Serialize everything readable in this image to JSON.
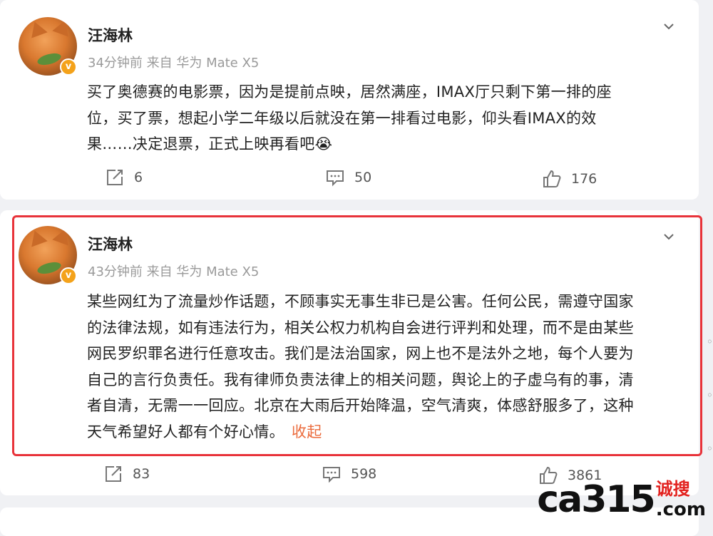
{
  "posts": [
    {
      "username": "汪海林",
      "meta": "34分钟前 来自 华为 Mate X5",
      "text_lines": [
        "买了奥德赛的电影票，因为是提前点映，居然满座，IMAX厅只剩下第一排的座",
        "位，买了票，想起小学二年级以后就没在第一排看过电影，仰头看IMAX的效",
        "果……决定退票，正式上映再看吧😭"
      ],
      "reposts": "6",
      "comments": "50",
      "likes": "176"
    },
    {
      "username": "汪海林",
      "meta": "43分钟前 来自 华为 Mate X5",
      "text_lines": [
        "某些网红为了流量炒作话题，不顾事实无事生非已是公害。任何公民，需遵守国家",
        "的法律法规，如有违法行为，相关公权力机构自会进行评判和处理，而不是由某些",
        "网民罗织罪名进行任意攻击。我们是法治国家，网上也不是法外之地，每个人要为",
        "自己的言行负责任。我有律师负责法律上的相关问题，舆论上的子虚乌有的事，清",
        "者自清，无需一一回应。北京在大雨后开始降温，空气清爽，体感舒服多了，这种",
        "天气希望好人都有个好心情。"
      ],
      "collapse_label": "收起",
      "reposts": "83",
      "comments": "598",
      "likes": "3861"
    }
  ],
  "badge_glyph": "v",
  "watermark": {
    "main": "ca315",
    "cn": "诚搜",
    "com": ".com"
  },
  "colors": {
    "highlight": "#e8333a",
    "collapse": "#eb6b3c",
    "badge": "#f4a21a"
  },
  "icons": [
    "repost-icon",
    "comment-icon",
    "like-icon",
    "chevron-down-icon"
  ]
}
